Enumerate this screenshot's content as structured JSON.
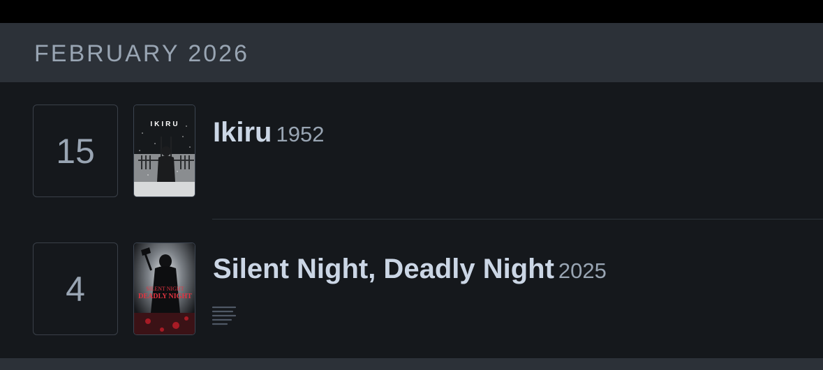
{
  "month_header": {
    "label": "FEBRUARY 2026"
  },
  "entries": [
    {
      "day": "15",
      "title": "Ikiru",
      "year": "1952",
      "poster_text": "IKIRU"
    },
    {
      "day": "4",
      "title": "Silent Night, Deadly Night",
      "year": "2025",
      "poster_text": "SILENT NIGHT DEADLY NIGHT",
      "has_review": true
    }
  ],
  "colors": {
    "background": "#15181c",
    "header": "#2c3138",
    "title": "#cbd6e5",
    "muted": "#99a5b3"
  },
  "icons": [
    "review-lines-icon"
  ]
}
